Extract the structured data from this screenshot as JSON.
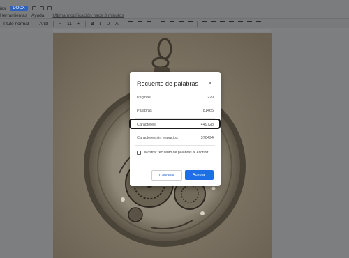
{
  "menubar": {
    "first_item": "ias",
    "badge": "DOCX",
    "items": [
      "Herramientas",
      "Ayuda"
    ],
    "last_edit": "Última modificación hace 3 minutos"
  },
  "toolbar": {
    "style": "Titulo normal",
    "font": "Arial",
    "font_size": "11",
    "plus": "+",
    "minus": "−",
    "bold": "B",
    "italic": "I",
    "underline": "U",
    "text_color": "A"
  },
  "dialog": {
    "title": "Recuento de palabras",
    "close": "×",
    "stats": [
      {
        "label": "Páginas",
        "value": "229"
      },
      {
        "label": "Palabras",
        "value": "81465"
      },
      {
        "label": "Caracteres",
        "value": "449728"
      },
      {
        "label": "Caracteres sin espacios",
        "value": "370494"
      }
    ],
    "checkbox_label": "Mostrar recuento de palabras al escribir",
    "checkbox_checked": false,
    "cancel_label": "Cancelar",
    "ok_label": "Aceptar"
  },
  "colors": {
    "accent": "#1e6ee6",
    "highlight_border": "#1a1a1a"
  }
}
